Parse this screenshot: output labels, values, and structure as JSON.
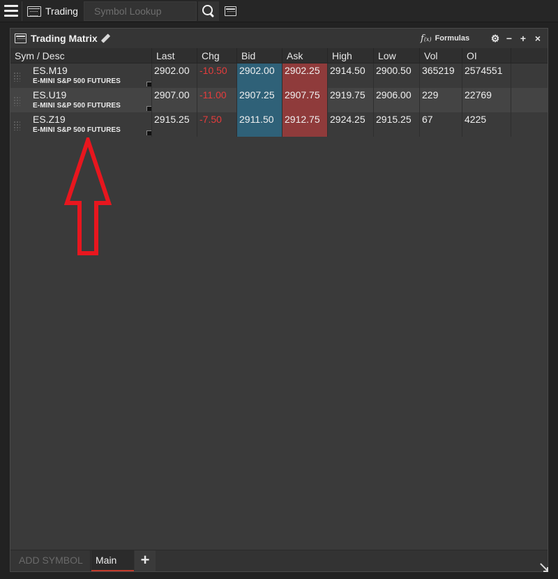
{
  "topbar": {
    "workspace_label": "Trading",
    "search_placeholder": "Symbol Lookup"
  },
  "panel": {
    "title": "Trading Matrix",
    "formulas_label": "Formulas",
    "formulas_fx": "f",
    "formulas_fx_sub": "(x)",
    "controls": {
      "settings": "⚙",
      "minimize": "−",
      "maximize": "+",
      "close": "×"
    }
  },
  "table": {
    "columns": [
      "Sym / Desc",
      "Last",
      "Chg",
      "Bid",
      "Ask",
      "High",
      "Low",
      "Vol",
      "OI"
    ],
    "rows": [
      {
        "symbol": "ES.M19",
        "desc": "E-MINI S&P 500 FUTURES",
        "last": "2902.00",
        "chg": "-10.50",
        "bid": "2902.00",
        "ask": "2902.25",
        "high": "2914.50",
        "low": "2900.50",
        "vol": "365219",
        "oi": "2574551"
      },
      {
        "symbol": "ES.U19",
        "desc": "E-MINI S&P 500 FUTURES",
        "last": "2907.00",
        "chg": "-11.00",
        "bid": "2907.25",
        "ask": "2907.75",
        "high": "2919.75",
        "low": "2906.00",
        "vol": "229",
        "oi": "22769"
      },
      {
        "symbol": "ES.Z19",
        "desc": "E-MINI S&P 500 FUTURES",
        "last": "2915.25",
        "chg": "-7.50",
        "bid": "2911.50",
        "ask": "2912.75",
        "high": "2924.25",
        "low": "2915.25",
        "vol": "67",
        "oi": "4225"
      }
    ]
  },
  "bottom": {
    "add_symbol": "ADD SYMBOL",
    "tabs": [
      {
        "label": "Main"
      }
    ],
    "add_tab": "+"
  },
  "colors": {
    "bid_bg": "#2f6178",
    "ask_bg": "#8f3b3b",
    "negative": "#e53c3c",
    "annotation_arrow": "#e8161e",
    "active_tab_underline": "#c23a2a"
  }
}
